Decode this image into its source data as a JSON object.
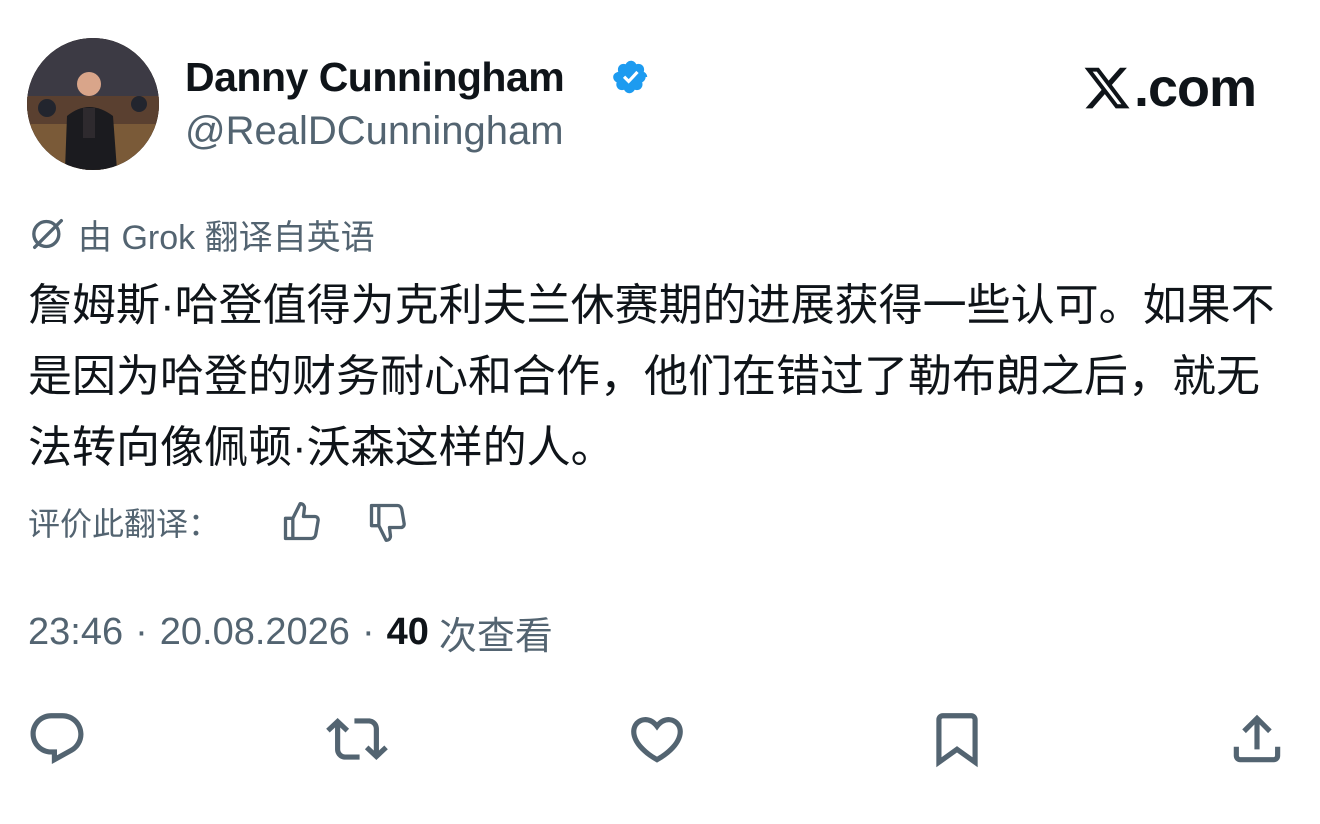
{
  "author": {
    "display_name": "Danny Cunningham",
    "handle": "@RealDCunningham",
    "verified": true
  },
  "brand": {
    "label": ".com",
    "icon": "x-logo-icon"
  },
  "translation_notice": "由 Grok 翻译自英语",
  "tweet_text": "詹姆斯·哈登值得为克利夫兰休赛期的进展获得一些认可。如果不是因为哈登的财务耐心和合作，他们在错过了勒布朗之后，就无法转向像佩顿·沃森这样的人。",
  "rate_translation": {
    "label": "评价此翻译：",
    "thumbs_up_icon": "thumbs-up-icon",
    "thumbs_down_icon": "thumbs-down-icon"
  },
  "meta": {
    "time": "23:46",
    "separator1": "·",
    "date": "20.08.2026",
    "separator2": "·",
    "views_count": "40",
    "views_label": "次查看"
  },
  "actions": [
    {
      "name": "reply",
      "icon": "reply-icon"
    },
    {
      "name": "retweet",
      "icon": "retweet-icon"
    },
    {
      "name": "like",
      "icon": "heart-icon"
    },
    {
      "name": "bookmark",
      "icon": "bookmark-icon"
    },
    {
      "name": "share",
      "icon": "share-icon"
    }
  ],
  "colors": {
    "text_primary": "#0f1419",
    "text_secondary": "#536471",
    "verified_blue": "#1d9bf0"
  }
}
